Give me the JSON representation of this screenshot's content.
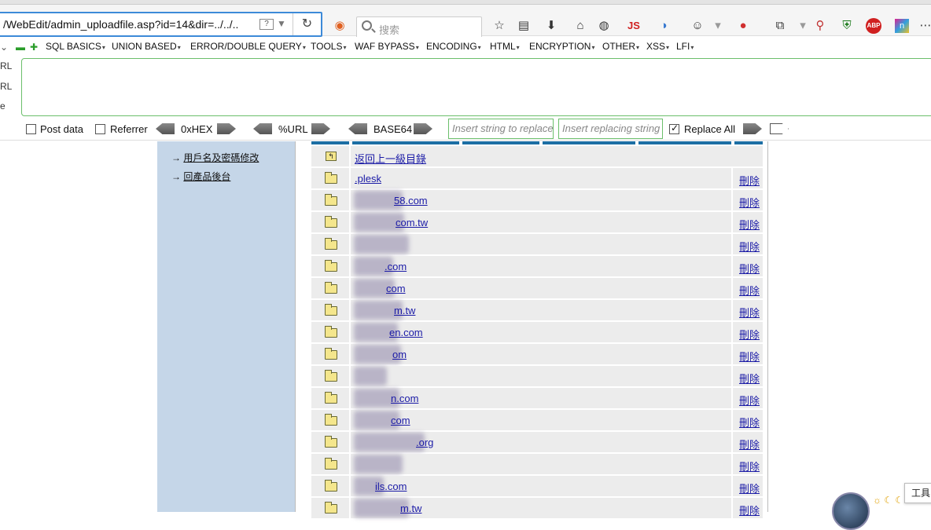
{
  "browser": {
    "url": "/WebEdit/admin_uploadfile.asp?id=14&dir=../../..",
    "url_help": "?",
    "search_placeholder": "搜索",
    "js_label": "JS",
    "abp_label": "ABP"
  },
  "hackbar": {
    "menu": [
      "SQL BASICS",
      "UNION BASED",
      "ERROR/DOUBLE QUERY",
      "TOOLS",
      "WAF BYPASS",
      "ENCODING",
      "HTML",
      "ENCRYPTION",
      "OTHER",
      "XSS",
      "LFI"
    ],
    "side_labels": [
      "RL",
      "RL",
      "e"
    ],
    "post_data_label": "Post data",
    "referrer_label": "Referrer",
    "hex_label": "0xHEX",
    "url_label": "%URL",
    "base64_label": "BASE64",
    "replace_placeholder": "Insert string to replace",
    "replacing_placeholder": "Insert replacing string",
    "replace_all_label": "Replace All",
    "post_data_checked": false,
    "referrer_checked": false,
    "replace_all_checked": true
  },
  "sidebar": {
    "links": [
      "用戶名及密碼修改",
      "回產品後台"
    ]
  },
  "filelist": {
    "up_label": "返回上一級目錄",
    "delete_label": "刪除",
    "items": [
      {
        "name": ".plesk"
      },
      {
        "name": "58.com"
      },
      {
        "name": "com.tw"
      },
      {
        "name": ""
      },
      {
        "name": ".com"
      },
      {
        "name": "com"
      },
      {
        "name": "m.tw"
      },
      {
        "name": "en.com"
      },
      {
        "name": "om"
      },
      {
        "name": ""
      },
      {
        "name": "n.com"
      },
      {
        "name": "com"
      },
      {
        "name": ".org"
      },
      {
        "name": ""
      },
      {
        "name": "ils.com"
      },
      {
        "name": "m.tw"
      }
    ]
  },
  "floating": {
    "tools_label": "工具"
  }
}
